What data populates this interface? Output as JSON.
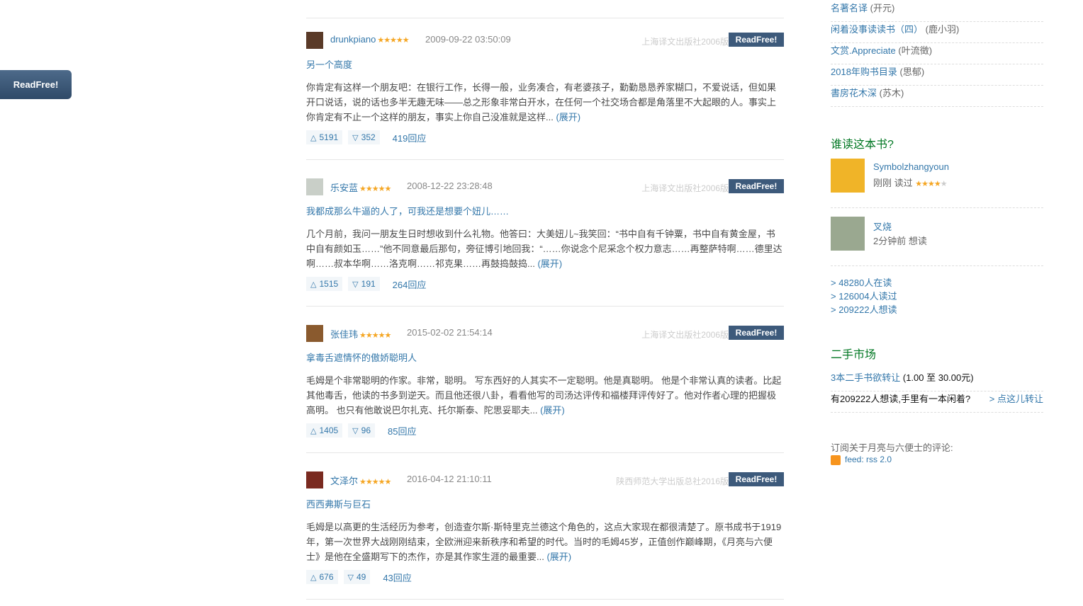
{
  "float_button": "ReadFree!",
  "reviews": [
    {
      "user": "drunkpiano",
      "stars": "★★★★★",
      "time": "2009-09-22 03:50:09",
      "publisher": "上海译文出版社2006版",
      "readfree": "ReadFree!",
      "title": "另一个高度",
      "body": "你肯定有这样一个朋友吧：在银行工作，长得一般，业务凑合，有老婆孩子，勤勤恳恳养家糊口，不爱说话，但如果开口说话，说的话也多半无趣无味——总之形象非常白开水，在任何一个社交场合都是角落里不大起眼的人。事实上你肯定有不止一个这样的朋友，事实上你自己没准就是这样...",
      "more": "(展开)",
      "up": "5191",
      "down": "352",
      "replies": "419回应",
      "avatar_color": "#5a3a28"
    },
    {
      "user": "乐安蓝",
      "stars": "★★★★★",
      "time": "2008-12-22 23:28:48",
      "publisher": "上海译文出版社2006版",
      "readfree": "ReadFree!",
      "title": "我都成那么牛逼的人了，可我还是想要个妞儿……",
      "body": "几个月前，我问一朋友生日时想收到什么礼物。他答曰：大美妞儿~我笑回：“书中自有千钟粟，书中自有黄金屋，书中自有颜如玉……”他不同意最后那句，旁征博引地回我：“……你说念个尼采念个权力意志……再整萨特啊……德里达啊……叔本华啊……洛克啊……祁克果……再鼓捣鼓捣...",
      "more": "(展开)",
      "up": "1515",
      "down": "191",
      "replies": "264回应",
      "avatar_color": "#c9cfc8"
    },
    {
      "user": "张佳玮",
      "stars": "★★★★★",
      "time": "2015-02-02 21:54:14",
      "publisher": "上海译文出版社2006版",
      "readfree": "ReadFree!",
      "title": "拿毒舌遮情怀的傲娇聪明人",
      "body": "毛姆是个非常聪明的作家。非常，聪明。 写东西好的人其实不一定聪明。他是真聪明。 他是个非常认真的读者。比起其他毒舌，他读的书多到逆天。而且他还很八卦，看看他写的司汤达评传和福楼拜评传好了。他对作者心理的把握极高明。 也只有他敢说巴尔扎克、托尔斯泰、陀思妥耶夫...",
      "more": "(展开)",
      "up": "1405",
      "down": "96",
      "replies": "85回应",
      "avatar_color": "#8a5a2e"
    },
    {
      "user": "文泽尔",
      "stars": "★★★★★",
      "time": "2016-04-12 21:10:11",
      "publisher": "陕西师范大学出版总社2016版",
      "readfree": "ReadFree!",
      "title": "西西弗斯与巨石",
      "body": "毛姆是以高更的生活经历为参考，创造查尔斯·斯特里克兰德这个角色的，这点大家现在都很清楚了。原书成书于1919年，第一次世界大战刚刚结束，全欧洲迎来新秩序和希望的时代。当时的毛姆45岁，正值创作巅峰期，《月亮与六便士》是他在全盛期写下的杰作，亦是其作家生涯的最重要...",
      "more": "(展开)",
      "up": "676",
      "down": "49",
      "replies": "43回应",
      "avatar_color": "#7a2a20"
    }
  ],
  "sidebar": {
    "doulists": [
      {
        "title": "名著名译",
        "author": "(开元)"
      },
      {
        "title": "闲着没事读读书（四）",
        "author": "(鹿小羽)"
      },
      {
        "title": "文赏.Appreciate",
        "author": "(叶流徵)"
      },
      {
        "title": "2018年购书目录",
        "author": "(思郁)"
      },
      {
        "title": "書房花木深",
        "author": "(苏木)"
      }
    ],
    "readers_title": "谁读这本书?",
    "readers": [
      {
        "name": "Symbolzhangyoun",
        "status": "刚刚 读过",
        "stars_on": "★★★★",
        "stars_off": "★",
        "pic_color": "#f0b428"
      },
      {
        "name": "叉烧",
        "status": "2分钟前 想读",
        "stars_on": "",
        "stars_off": "",
        "pic_color": "#9aa890"
      }
    ],
    "stats": [
      "> 48280人在读",
      "> 126004人读过",
      "> 209222人想读"
    ],
    "market_title": "二手市场",
    "market_link": "3本二手书欲转让",
    "market_price": "(1.00 至 30.00元)",
    "market_prompt": "有209222人想读,手里有一本闲着?",
    "market_action": "> 点这儿转让",
    "feed_label": "订阅关于月亮与六便士的评论:",
    "feed_link": "feed: rss 2.0"
  }
}
